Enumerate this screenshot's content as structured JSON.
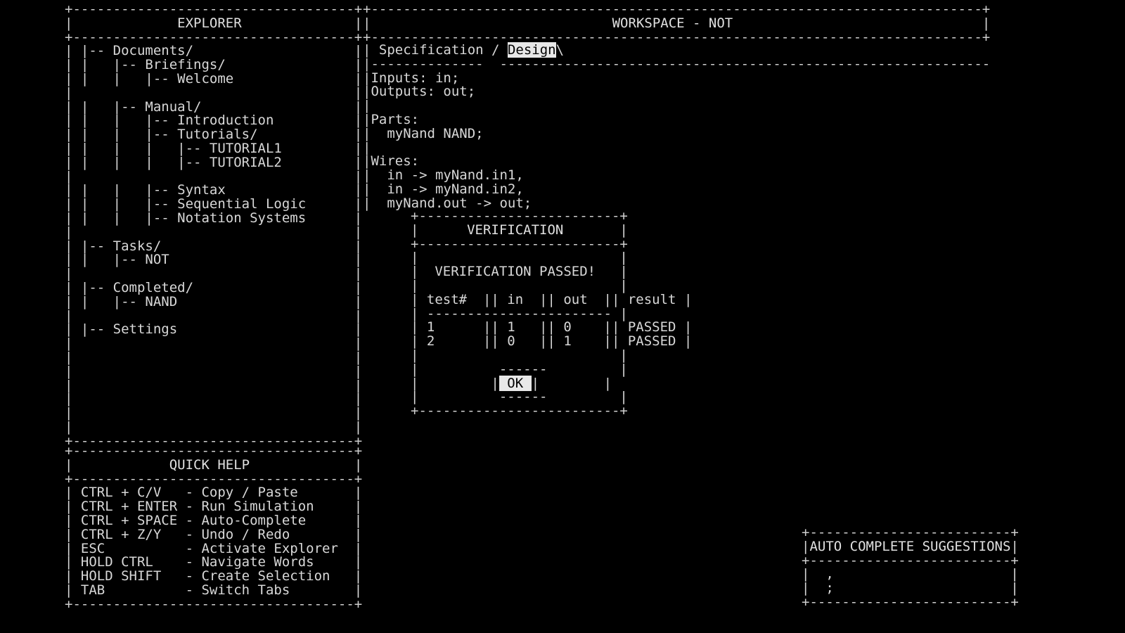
{
  "theme": {
    "background": "#000000",
    "foreground": "#d8d8d8",
    "border": "#cfcfcf",
    "highlight_bg": "#e8e8e8",
    "highlight_fg": "#000000"
  },
  "explorer": {
    "title": "EXPLORER",
    "tree": [
      {
        "prefix": " |-- ",
        "label": "Documents/"
      },
      {
        "prefix": " |   |-- ",
        "label": "Briefings/"
      },
      {
        "prefix": " |   |   |-- ",
        "label": "Welcome"
      },
      {
        "prefix": "",
        "label": ""
      },
      {
        "prefix": " |   |-- ",
        "label": "Manual/"
      },
      {
        "prefix": " |   |   |-- ",
        "label": "Introduction"
      },
      {
        "prefix": " |   |   |-- ",
        "label": "Tutorials/"
      },
      {
        "prefix": " |   |   |   |-- ",
        "label": "TUTORIAL1"
      },
      {
        "prefix": " |   |   |   |-- ",
        "label": "TUTORIAL2"
      },
      {
        "prefix": "",
        "label": ""
      },
      {
        "prefix": " |   |   |-- ",
        "label": "Syntax"
      },
      {
        "prefix": " |   |   |-- ",
        "label": "Sequential Logic"
      },
      {
        "prefix": " |   |   |-- ",
        "label": "Notation Systems"
      },
      {
        "prefix": "",
        "label": ""
      },
      {
        "prefix": " |-- ",
        "label": "Tasks/"
      },
      {
        "prefix": " |   |-- ",
        "label": "NOT"
      },
      {
        "prefix": "",
        "label": ""
      },
      {
        "prefix": " |-- ",
        "label": "Completed/"
      },
      {
        "prefix": " |   |-- ",
        "label": "NAND"
      },
      {
        "prefix": "",
        "label": ""
      },
      {
        "prefix": " |-- ",
        "label": "Settings"
      }
    ]
  },
  "quick_help": {
    "title": "QUICK HELP",
    "shortcuts": [
      {
        "keys": "CTRL + C/V",
        "action": "Copy / Paste"
      },
      {
        "keys": "CTRL + ENTER",
        "action": "Run Simulation"
      },
      {
        "keys": "CTRL + SPACE",
        "action": "Auto-Complete"
      },
      {
        "keys": "CTRL + Z/Y",
        "action": "Undo / Redo"
      },
      {
        "keys": "ESC",
        "action": "Activate Explorer"
      },
      {
        "keys": "HOLD CTRL",
        "action": "Navigate Words"
      },
      {
        "keys": "HOLD SHIFT",
        "action": "Create Selection"
      },
      {
        "keys": "TAB",
        "action": "Switch Tabs"
      }
    ]
  },
  "workspace": {
    "title": "WORKSPACE - NOT",
    "tabs": [
      {
        "label": "Specification",
        "active": false
      },
      {
        "label": "Design",
        "active": true
      }
    ],
    "tab_separator": "/",
    "tab_trailing": "\\",
    "code_lines": [
      "Inputs: in;",
      "Outputs: out;",
      "",
      "Parts:",
      "  myNand NAND;",
      "",
      "Wires:",
      "  in -> myNand.in1,",
      "  in -> myNand.in2,",
      "  myNand.out -> out;"
    ]
  },
  "verification_dialog": {
    "title": "VERIFICATION",
    "status": "VERIFICATION PASSED!",
    "columns": [
      "test#",
      "in",
      "out",
      "result"
    ],
    "column_separator": "||",
    "rows": [
      {
        "test": "1",
        "in": "1",
        "out": "0",
        "result": "PASSED"
      },
      {
        "test": "2",
        "in": "0",
        "out": "1",
        "result": "PASSED"
      }
    ],
    "ok_button": "OK"
  },
  "autocomplete": {
    "title": "AUTO COMPLETE SUGGESTIONS",
    "suggestions": [
      ",",
      ";"
    ]
  }
}
